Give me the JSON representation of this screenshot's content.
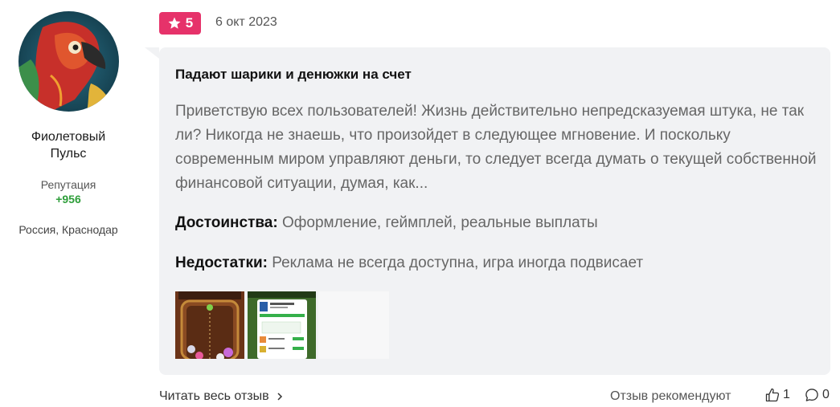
{
  "author": {
    "name_line1": "Фиолетовый",
    "name_line2": "Пульс",
    "reputation_label": "Репутация",
    "reputation_value": "+956",
    "location": "Россия, Краснодар"
  },
  "review": {
    "rating": "5",
    "date": "6 окт 2023",
    "title": "Падают шарики и денюжки на счет",
    "body": "Приветствую всех пользователей! Жизнь действительно непредсказуемая штука, не так ли? Никогда не знаешь, что произойдет в следующее мгновение. И поскольку современным миром управляют деньги, то следует всегда думать о текущей собственной финансовой ситуации, думая, как...",
    "pros_label": "Достоинства:",
    "pros_text": " Оформление, геймплей, реальные выплаты",
    "cons_label": "Недостатки:",
    "cons_text": " Реклама не всегда доступна, игра иногда подвисает"
  },
  "footer": {
    "read_more": "Читать весь отзыв",
    "recommend": "Отзыв рекомендуют",
    "likes": "1",
    "comments": "0"
  },
  "colors": {
    "rating_badge": "#e6326a",
    "reputation": "#2e9e3a",
    "bubble": "#f1f2f4"
  }
}
